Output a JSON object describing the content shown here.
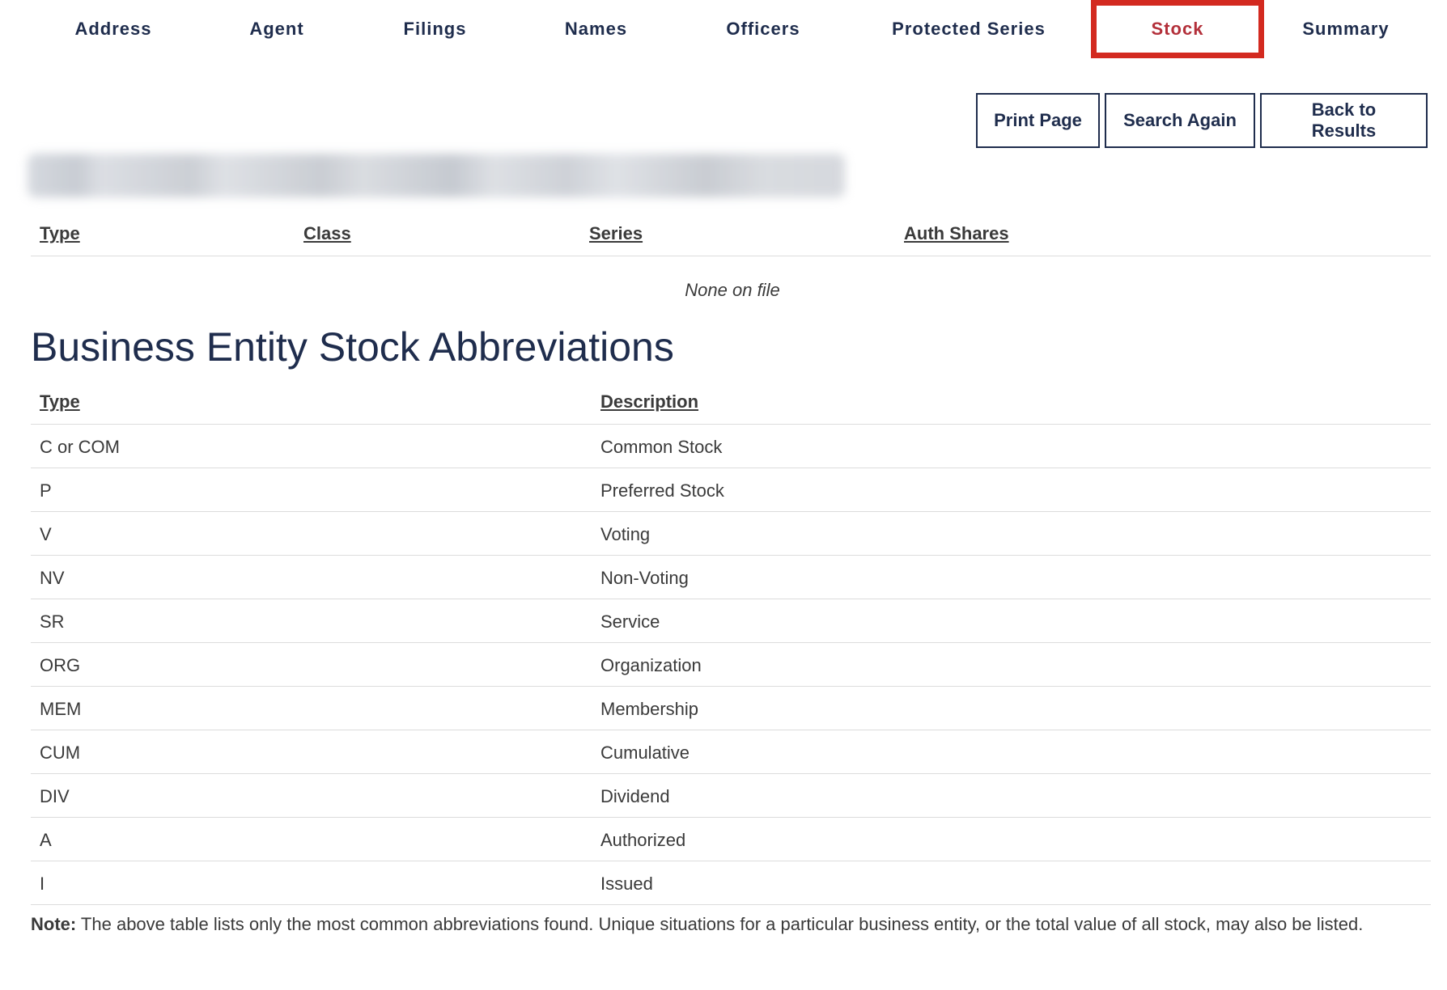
{
  "nav": {
    "tabs": [
      {
        "label": "Address",
        "active": false
      },
      {
        "label": "Agent",
        "active": false
      },
      {
        "label": "Filings",
        "active": false
      },
      {
        "label": "Names",
        "active": false
      },
      {
        "label": "Officers",
        "active": false
      },
      {
        "label": "Protected Series",
        "active": false
      },
      {
        "label": "Stock",
        "active": true
      },
      {
        "label": "Summary",
        "active": false
      }
    ]
  },
  "actions": {
    "print_label": "Print Page",
    "search_label": "Search Again",
    "back_label": "Back to Results"
  },
  "stock_table": {
    "headers": [
      "Type",
      "Class",
      "Series",
      "Auth Shares"
    ],
    "empty_message": "None on file"
  },
  "abbreviations": {
    "title": "Business Entity Stock Abbreviations",
    "headers": [
      "Type",
      "Description"
    ],
    "rows": [
      {
        "type": "C or COM",
        "description": "Common Stock"
      },
      {
        "type": "P",
        "description": "Preferred Stock"
      },
      {
        "type": "V",
        "description": "Voting"
      },
      {
        "type": "NV",
        "description": "Non-Voting"
      },
      {
        "type": "SR",
        "description": "Service"
      },
      {
        "type": "ORG",
        "description": "Organization"
      },
      {
        "type": "MEM",
        "description": "Membership"
      },
      {
        "type": "CUM",
        "description": "Cumulative"
      },
      {
        "type": "DIV",
        "description": "Dividend"
      },
      {
        "type": "A",
        "description": "Authorized"
      },
      {
        "type": "I",
        "description": "Issued"
      }
    ]
  },
  "note": {
    "label": "Note:",
    "text": " The above table lists only the most common abbreviations found.  Unique situations for a particular business entity, or the total value of all stock, may also be listed."
  },
  "colors": {
    "nav_text": "#1f2d4d",
    "active_tab_text": "#b3303a",
    "active_tab_outline": "#d32a20",
    "body_text": "#3a3a3a"
  }
}
